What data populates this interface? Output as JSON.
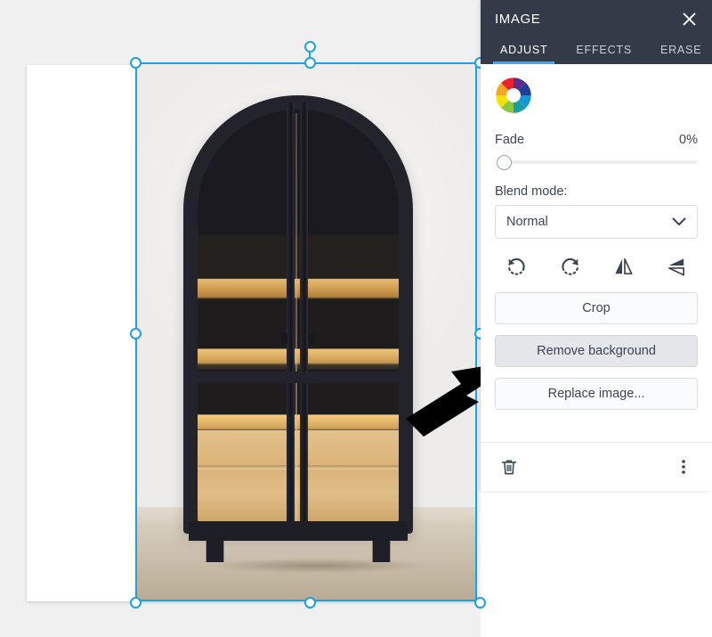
{
  "panel": {
    "title": "IMAGE",
    "close_icon": "close-icon",
    "tabs": [
      {
        "label": "ADJUST",
        "active": true
      },
      {
        "label": "EFFECTS",
        "active": false
      },
      {
        "label": "ERASE",
        "active": false
      }
    ],
    "color_wheel_icon": "color-wheel-icon",
    "fade": {
      "label": "Fade",
      "value_label": "0%",
      "value": 0,
      "min": 0,
      "max": 100
    },
    "blend_mode": {
      "label": "Blend mode:",
      "value": "Normal",
      "chevron_icon": "chevron-down-icon"
    },
    "transform_icons": [
      {
        "name": "rotate-left-icon"
      },
      {
        "name": "rotate-right-icon"
      },
      {
        "name": "flip-horizontal-icon"
      },
      {
        "name": "flip-vertical-icon"
      }
    ],
    "buttons": [
      {
        "label": "Crop",
        "state": "normal"
      },
      {
        "label": "Remove background",
        "state": "hovered"
      },
      {
        "label": "Replace image...",
        "state": "normal"
      }
    ],
    "footer": {
      "delete_icon": "trash-icon",
      "more_icon": "more-vertical-icon"
    },
    "accent_color": "#3fa9f5",
    "header_color": "#333b49",
    "text_color": "#3c4453"
  },
  "canvas": {
    "selection": {
      "color": "#1ea0e8",
      "handle_count": 8,
      "rotate_handle": "rotate-handle"
    },
    "image": {
      "alt": "black arched display cabinet with wooden shelves against a white wall"
    },
    "pointer": {
      "name": "arrow-pointer",
      "color": "#000000"
    }
  }
}
